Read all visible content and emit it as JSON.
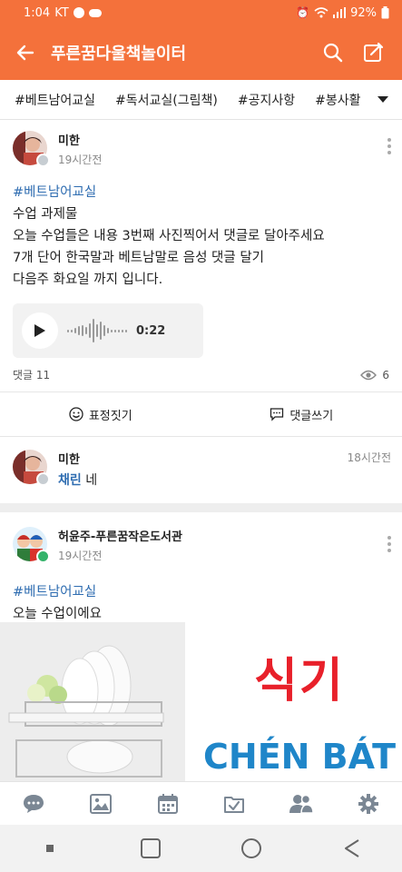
{
  "status_bar": {
    "time": "1:04",
    "carrier": "KT",
    "battery": "92%"
  },
  "header": {
    "title": "푸른꿈다울책놀이터"
  },
  "tags": [
    "#베트남어교실",
    "#독서교실(그림책)",
    "#공지사항",
    "#봉사활"
  ],
  "post1": {
    "author": "미한",
    "time": "19시간전",
    "hashtag": "#베트남어교실",
    "lines": [
      "수업 과제물",
      "오늘 수업들은 내용 3번째 사진찍어서 댓글로 달아주세요",
      "7개 단어 한국말과 베트남말로 음성 댓글 달기",
      "다음주 화요일 까지 입니다."
    ],
    "audio_duration": "0:22",
    "comments_label": "댓글 11",
    "views": "6",
    "action_emoji": "표정짓기",
    "action_comment": "댓글쓰기"
  },
  "comment1": {
    "author": "미한",
    "mention": "채린",
    "text": " 네",
    "time": "18시간전"
  },
  "post2": {
    "author": "허윤주-푸른꿈작은도서관",
    "time": "19시간전",
    "hashtag": "#베트남어교실",
    "line": "오늘 수업이에요",
    "image_text_ko": "식기",
    "image_text_vi": "CHÉN BÁT"
  },
  "colors": {
    "brand": "#f4713b",
    "hashtag": "#2f6db1",
    "image_red": "#e8202a",
    "image_blue": "#1f86c9"
  },
  "icons": {
    "header": [
      "back-arrow-icon",
      "search-icon",
      "compose-icon"
    ],
    "app_nav": [
      "chat-icon",
      "photo-icon",
      "calendar-icon",
      "checklist-icon",
      "members-icon",
      "settings-icon"
    ],
    "system_nav": [
      "recents-icon",
      "home-icon",
      "back-icon"
    ]
  }
}
